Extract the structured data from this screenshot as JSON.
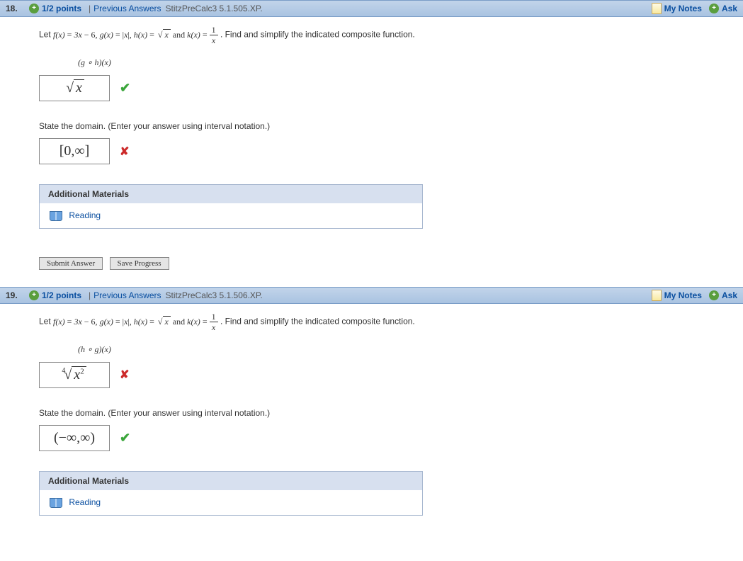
{
  "questions": [
    {
      "number": "18.",
      "points": "1/2 points",
      "prev": "Previous Answers",
      "ref": "StitzPreCalc3 5.1.505.XP.",
      "mynotes": "My Notes",
      "ask": "Ask",
      "prompt_pre": "Let  ",
      "prompt_post": ".  Find and simplify the indicated composite function.",
      "sub": "(g ∘ h)(x)",
      "ans1_correct": true,
      "domain_label": "State the domain. (Enter your answer using interval notation.)",
      "ans2_text": "[0,∞]",
      "ans2_correct": false,
      "addmat": "Additional Materials",
      "reading": "Reading",
      "submit": "Submit Answer",
      "save": "Save Progress"
    },
    {
      "number": "19.",
      "points": "1/2 points",
      "prev": "Previous Answers",
      "ref": "StitzPreCalc3 5.1.506.XP.",
      "mynotes": "My Notes",
      "ask": "Ask",
      "prompt_pre": "Let  ",
      "prompt_post": ".  Find and simplify the indicated composite function.",
      "sub": "(h ∘ g)(x)",
      "ans1_correct": false,
      "domain_label": "State the domain. (Enter your answer using interval notation.)",
      "ans2_text": "(−∞,∞)",
      "ans2_correct": true,
      "addmat": "Additional Materials",
      "reading": "Reading"
    }
  ]
}
